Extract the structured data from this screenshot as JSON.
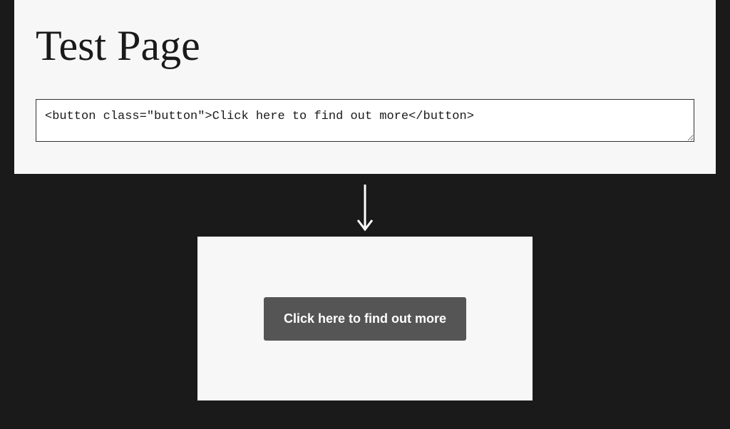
{
  "top": {
    "title": "Test Page",
    "code": "<button class=\"button\">Click here to find out more</button>"
  },
  "arrow": {
    "name": "arrow-down"
  },
  "bottom": {
    "button_label": "Click here to find out more"
  }
}
